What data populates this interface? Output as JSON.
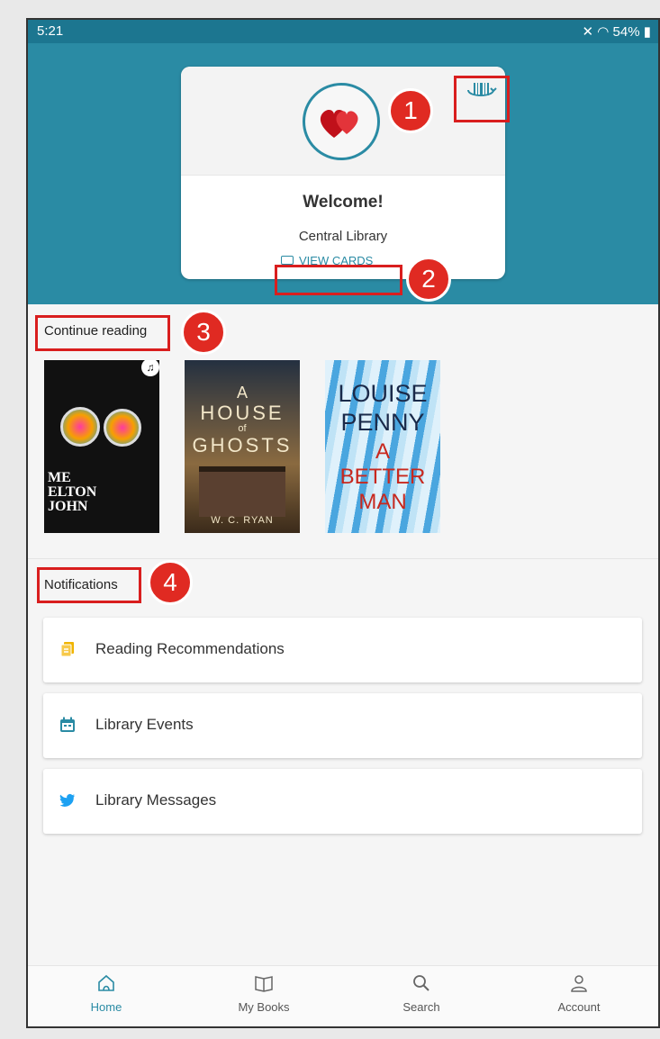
{
  "status": {
    "time": "5:21",
    "indicators": "54%"
  },
  "card": {
    "welcome": "Welcome!",
    "library_name": "Central Library",
    "view_cards_label": "VIEW CARDS"
  },
  "callouts": [
    "1",
    "2",
    "3",
    "4"
  ],
  "continue_reading": {
    "title": "Continue reading",
    "books": [
      {
        "cover_text": [
          "ME",
          "ELTON",
          "JOHN"
        ]
      },
      {
        "cover_text": [
          "A",
          "HOUSE",
          "of",
          "GHOSTS",
          "W. C. RYAN"
        ]
      },
      {
        "cover_text": [
          "LOUISE",
          "PENNY",
          "A",
          "BETTER",
          "MAN"
        ]
      }
    ]
  },
  "notifications": {
    "title": "Notifications",
    "items": [
      {
        "label": "Reading Recommendations",
        "icon": "recommendations-icon",
        "color": "#f0b400"
      },
      {
        "label": "Library Events",
        "icon": "calendar-icon",
        "color": "#2a8ba4"
      },
      {
        "label": "Library Messages",
        "icon": "twitter-bird-icon",
        "color": "#1da1f2"
      }
    ]
  },
  "bottom_nav": [
    {
      "label": "Home",
      "active": true
    },
    {
      "label": "My Books",
      "active": false
    },
    {
      "label": "Search",
      "active": false
    },
    {
      "label": "Account",
      "active": false
    }
  ],
  "colors": {
    "header": "#2a8ba4",
    "status_bar": "#1c7690",
    "accent": "#2a8ba4",
    "callout": "#e02a22"
  }
}
